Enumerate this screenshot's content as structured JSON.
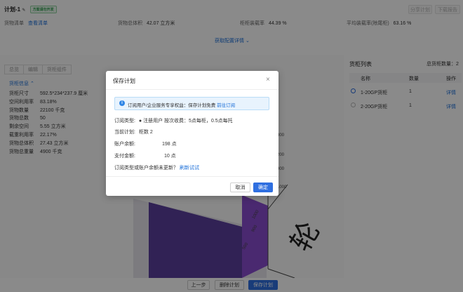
{
  "page": {
    "title": "计划-1",
    "status_tag": "方案请勿开发"
  },
  "top_buttons": {
    "share": "分享计划",
    "download": "下载报告"
  },
  "summary": {
    "cargo_list_label": "货物清单",
    "cargo_list_value": "查看清单",
    "total_volume_label": "货物总体积",
    "total_volume_value": "42.07 立方米",
    "cabinet_rate_label": "柜柜装载率",
    "cabinet_rate_value": "44.39 %",
    "avg_rate_label": "平均装载率(除尾柜)",
    "avg_rate_value": "63.16 %"
  },
  "config_link": "获取配置详情",
  "view_tabs": [
    "总览",
    "编辑",
    "货柜组件"
  ],
  "cabinet_info": {
    "toggle": "货柜信息",
    "rows": [
      {
        "label": "货柜尺寸",
        "value": "592.5*234*237.9 厘米"
      },
      {
        "label": "空间利用率",
        "value": "83.18%"
      },
      {
        "label": "货物数量",
        "value": "22100 千克"
      },
      {
        "label": "货物总数",
        "value": "50"
      },
      {
        "label": "剩余空间",
        "value": "5.55 立方米"
      },
      {
        "label": "载重利用率",
        "value": "22.17%"
      },
      {
        "label": "货物总体积",
        "value": "27.43 立方米"
      },
      {
        "label": "货物总重量",
        "value": "4900 千克"
      }
    ]
  },
  "scene": {
    "axis_ticks": [
      "800",
      "900",
      "1000",
      "1000",
      "900",
      "500",
      "200"
    ],
    "wheel_label": "轮"
  },
  "right_panel": {
    "title": "货柜列表",
    "total": "总货柜数量：2",
    "columns": [
      "名称",
      "数量",
      "操作"
    ],
    "rows": [
      {
        "name": "1-20GP货柜",
        "qty": "1",
        "action": "详情"
      },
      {
        "name": "2-20GP货柜",
        "qty": "1",
        "action": "详情"
      }
    ]
  },
  "bottom_buttons": {
    "prev": "上一步",
    "delete": "删除计划",
    "save": "保存计划"
  },
  "dialog": {
    "title": "保存计划",
    "notice_text": "订阅用户/企业服务专享权益：保存计划免费",
    "notice_link": "前往订阅",
    "subscription_type_label": "订阅类型:",
    "subscription_type_value": "● 注册用户  按次收费：5点每柜，0.5点每托",
    "current_plan_label": "当前计划:",
    "current_plan_value": "柜数 2",
    "balance_label": "账户余额:",
    "balance_value": "198 点",
    "payment_label": "支付金额:",
    "payment_value": "10 点",
    "update_text": "订阅类型或账户余额未更新？",
    "refresh_link": "刷新试试",
    "cancel": "取消",
    "confirm": "确定"
  }
}
